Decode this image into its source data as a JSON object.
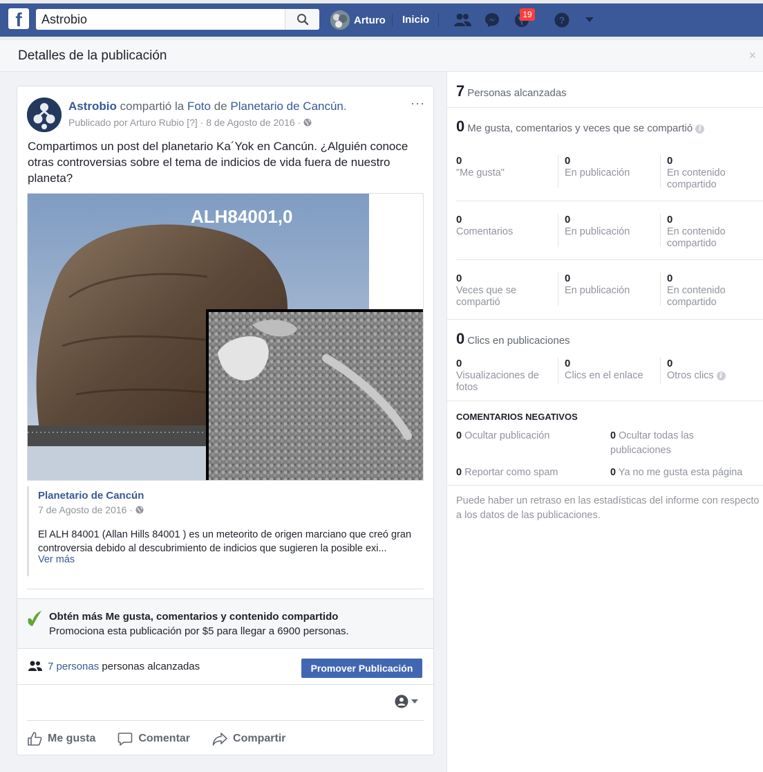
{
  "topbar": {
    "logo_letter": "f",
    "search_value": "Astrobio",
    "user_name": "Arturo",
    "home_label": "Inicio",
    "notifications_count": "19"
  },
  "dialog": {
    "title": "Detalles de la publicación",
    "close_glyph": "×"
  },
  "post": {
    "page_name": "Astrobio",
    "shared_text": "compartió la",
    "photo_link": "Foto",
    "of_text": "de",
    "source_page": "Planetario de Cancún",
    "period": ".",
    "meta": "Publicado por Arturo Rubio [?] · 8 de Agosto de 2016 ·",
    "more_glyph": "···",
    "body": "Compartimos un post del planetario Ka´Yok en Cancún. ¿Alguién conoce otras controversias sobre el tema de indicios de vida fuera de nuestro planeta?",
    "image_label": "ALH84001,0"
  },
  "attachment": {
    "name": "Planetario de Cancún",
    "date": "7 de Agosto de 2016 ·",
    "text": "El ALH 84001 (Allan Hills 84001 ) es un meteorito de origen marciano que creó gran controversia debido al descubrimiento de indicios que sugieren la posible exi...",
    "more": "Ver más"
  },
  "promo": {
    "title": "Obtén más Me gusta, comentarios y contenido compartido",
    "subtitle": "Promociona esta publicación por $5 para llegar a 6900 personas."
  },
  "reach": {
    "link": "7 personas",
    "text": "personas alcanzadas",
    "button": "Promover Publicación"
  },
  "actions": {
    "like": "Me gusta",
    "comment": "Comentar",
    "share": "Compartir"
  },
  "stats": {
    "reached_num": "7",
    "reached_label": "Personas alcanzadas",
    "engagement_num": "0",
    "engagement_label": "Me gusta, comentarios y veces que se compartió",
    "rows": [
      [
        {
          "v": "0",
          "l": "\"Me gusta\""
        },
        {
          "v": "0",
          "l": "En publicación"
        },
        {
          "v": "0",
          "l": "En contenido compartido"
        }
      ],
      [
        {
          "v": "0",
          "l": "Comentarios"
        },
        {
          "v": "0",
          "l": "En publicación"
        },
        {
          "v": "0",
          "l": "En contenido compartido"
        }
      ],
      [
        {
          "v": "0",
          "l": "Veces que se compartió"
        },
        {
          "v": "0",
          "l": "En publicación"
        },
        {
          "v": "0",
          "l": "En contenido compartido"
        }
      ]
    ],
    "clicks_num": "0",
    "clicks_label": "Clics en publicaciones",
    "clicks": [
      {
        "v": "0",
        "l": "Visualizaciones de fotos"
      },
      {
        "v": "0",
        "l": "Clics en el enlace"
      },
      {
        "v": "0",
        "l": "Otros clics"
      }
    ],
    "negative_title": "COMENTARIOS NEGATIVOS",
    "negative": [
      {
        "n": "0",
        "l": "Ocultar publicación"
      },
      {
        "n": "0",
        "l": "Ocultar todas las publicaciones"
      },
      {
        "n": "0",
        "l": "Reportar como spam"
      },
      {
        "n": "0",
        "l": "Ya no me gusta esta página"
      }
    ],
    "disclaimer": "Puede haber un retraso en las estadísticas del informe con respecto a los datos de las publicaciones."
  }
}
